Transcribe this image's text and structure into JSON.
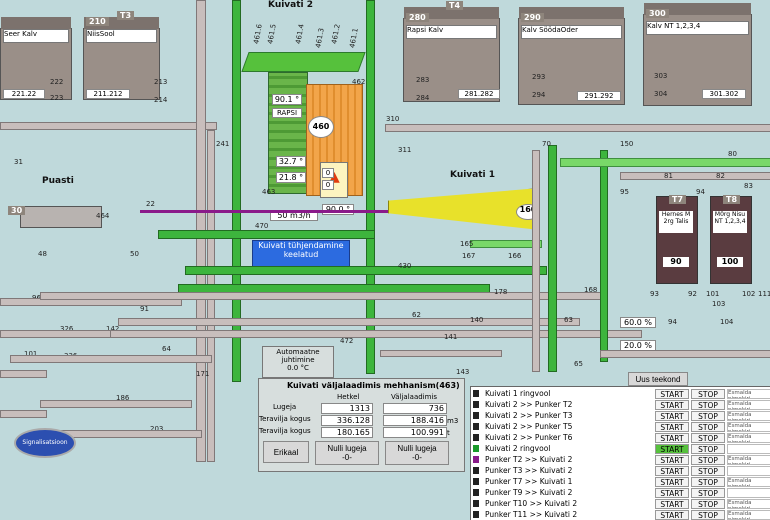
{
  "top_left": {
    "title": "Kuivati 2"
  },
  "silos": {
    "s1": {
      "badge": "",
      "name": "Seer Kalv",
      "counter": "221.22"
    },
    "s2": {
      "badge": "T3",
      "num": "210",
      "name": "NiisSool",
      "counter": "211.212"
    },
    "t4": {
      "badge": "T4",
      "num": "280",
      "name": "Rapsi Kalv",
      "counter": "281.282"
    },
    "t5": {
      "badge": "T5",
      "num": "290",
      "name": "Kalv SöödaOder",
      "counter": "291.292"
    },
    "t6": {
      "num": "300",
      "name": "Kalv NT 1,2,3,4",
      "counter": "301.302"
    }
  },
  "nodes": {
    "n212": "212",
    "n213": "213",
    "n214": "214",
    "n222": "222",
    "n223": "223",
    "n283": "283",
    "n284": "284",
    "n293": "293",
    "n294": "294",
    "n303": "303",
    "n304": "304",
    "n310": "310",
    "n311": "311",
    "n241": "241",
    "n31": "31",
    "n30": "30",
    "n22": "22",
    "n464": "464",
    "n463": "463",
    "n462": "462",
    "n460": "460",
    "n90_5": "90,5",
    "n50": "50",
    "n48": "48",
    "n96": "96",
    "n91": "91",
    "n326": "326",
    "n142": "142",
    "n64": "64",
    "n471": "471",
    "n470": "470",
    "n472": "472",
    "n101": "101",
    "n336": "336",
    "n171": "171",
    "n186": "186",
    "n203": "203",
    "n430": "430",
    "n165": "165",
    "n167": "167",
    "n166": "166",
    "n178": "178",
    "n168": "168",
    "n140": "140",
    "n141": "141",
    "n143": "143",
    "n62": "62",
    "n63": "63",
    "n65": "65",
    "n70": "70",
    "n150": "150",
    "n80": "80",
    "n81": "81",
    "n82": "82",
    "n83": "83",
    "n95": "95",
    "n94": "94",
    "n93": "93",
    "n92": "92",
    "n101b": "101",
    "n102": "102",
    "n103": "103",
    "n104": "104",
    "n111": "111",
    "n461_6": "461.6",
    "n461_5": "461.5",
    "n461_4": "461.4",
    "n461_3": "461.3",
    "n461_2": "461.2",
    "n461_1": "461.1"
  },
  "dryer2": {
    "temp1": "90.1 °",
    "label": "RAPSI",
    "temp2": "32.7 °",
    "temp3": "21.8 °",
    "flow": "50 m3/h",
    "burner_temp": "90.0 °",
    "v0": "0",
    "v1": "0"
  },
  "dryer1": {
    "title": "Kuivati 1",
    "badge": "160"
  },
  "puasti": {
    "title": "Puasti"
  },
  "warning": {
    "text": "Kuivati tühjendamine keelatud"
  },
  "tanks": {
    "t7": {
      "badge": "T7",
      "name": "Hernes M 2rg Talis",
      "level": "90"
    },
    "t8": {
      "badge": "T8",
      "name": "M0rg Nisu NT 1,2,3,4",
      "level": "100"
    }
  },
  "pct1": "60.0 %",
  "pct2": "20.0 %",
  "auto_box": {
    "title": "Automaatne juhtimine",
    "value": "0.0 °C"
  },
  "new_order_button": "Uus teekond",
  "signal_button": "Signalisatsioon",
  "meter_panel": {
    "title": "Kuivati väljalaadimis mehhanism(463)",
    "col1": "Hetkel",
    "col2": "Väljalaadimis",
    "rows": [
      {
        "label": "Lugeja",
        "v1": "1313",
        "v2": "736",
        "unit": ""
      },
      {
        "label": "Teravilja kogus",
        "v1": "336.128",
        "v2": "188.416",
        "unit": "m3"
      },
      {
        "label": "Teravilja kogus",
        "v1": "180.165",
        "v2": "100.991",
        "unit": "t"
      }
    ],
    "buttons": [
      "Erikaal",
      "Nulli lugeja -0-",
      "Nulli lugeja -0-"
    ]
  },
  "routes": [
    {
      "name": "Kuivati 1 ringvool",
      "color": "#222222",
      "start": "START",
      "stop": "STOP",
      "comment": "Esmalda nimekiri"
    },
    {
      "name": "Kuivati 2 >> Punker T2",
      "color": "#222222",
      "start": "START",
      "stop": "STOP",
      "comment": "Esmalda nimekiri"
    },
    {
      "name": "Kuivati 2 >> Punker T3",
      "color": "#222222",
      "start": "START",
      "stop": "STOP",
      "comment": "Esmalda nimekiri"
    },
    {
      "name": "Kuivati 2 >> Punker T5",
      "color": "#222222",
      "start": "START",
      "stop": "STOP",
      "comment": "Esmalda nimekiri"
    },
    {
      "name": "Kuivati 2 >> Punker T6",
      "color": "#222222",
      "start": "START",
      "stop": "STOP",
      "comment": "Esmalda nimekiri"
    },
    {
      "name": "Kuivati 2 ringvool",
      "color": "#1a9a2a",
      "start": "START",
      "stop": "STOP",
      "comment": ""
    },
    {
      "name": "Punker T2 >> Kuivati 2",
      "color": "#8a1a8a",
      "start": "START",
      "stop": "STOP",
      "comment": "Esmalda nimekiri"
    },
    {
      "name": "Punker T3 >> Kuivati 2",
      "color": "#222222",
      "start": "START",
      "stop": "STOP",
      "comment": ""
    },
    {
      "name": "Punker T7 >> Kuivati 1",
      "color": "#222222",
      "start": "START",
      "stop": "STOP",
      "comment": "Esmalda nimekiri"
    },
    {
      "name": "Punker T9 >> Kuivati 2",
      "color": "#222222",
      "start": "START",
      "stop": "STOP",
      "comment": ""
    },
    {
      "name": "Punker T10 >> Kuivati 2",
      "color": "#222222",
      "start": "START",
      "stop": "STOP",
      "comment": "Esmalda nimekiri"
    },
    {
      "name": "Punker T11 >> Kuivati 2",
      "color": "#222222",
      "start": "START",
      "stop": "STOP",
      "comment": "Esmalda nimekiri"
    }
  ],
  "active_start_index": 5,
  "colors": {
    "green": "#3db53d",
    "yellow": "#e8e12a",
    "orange": "#f2a54a",
    "warning_blue": "#2c6be0"
  }
}
